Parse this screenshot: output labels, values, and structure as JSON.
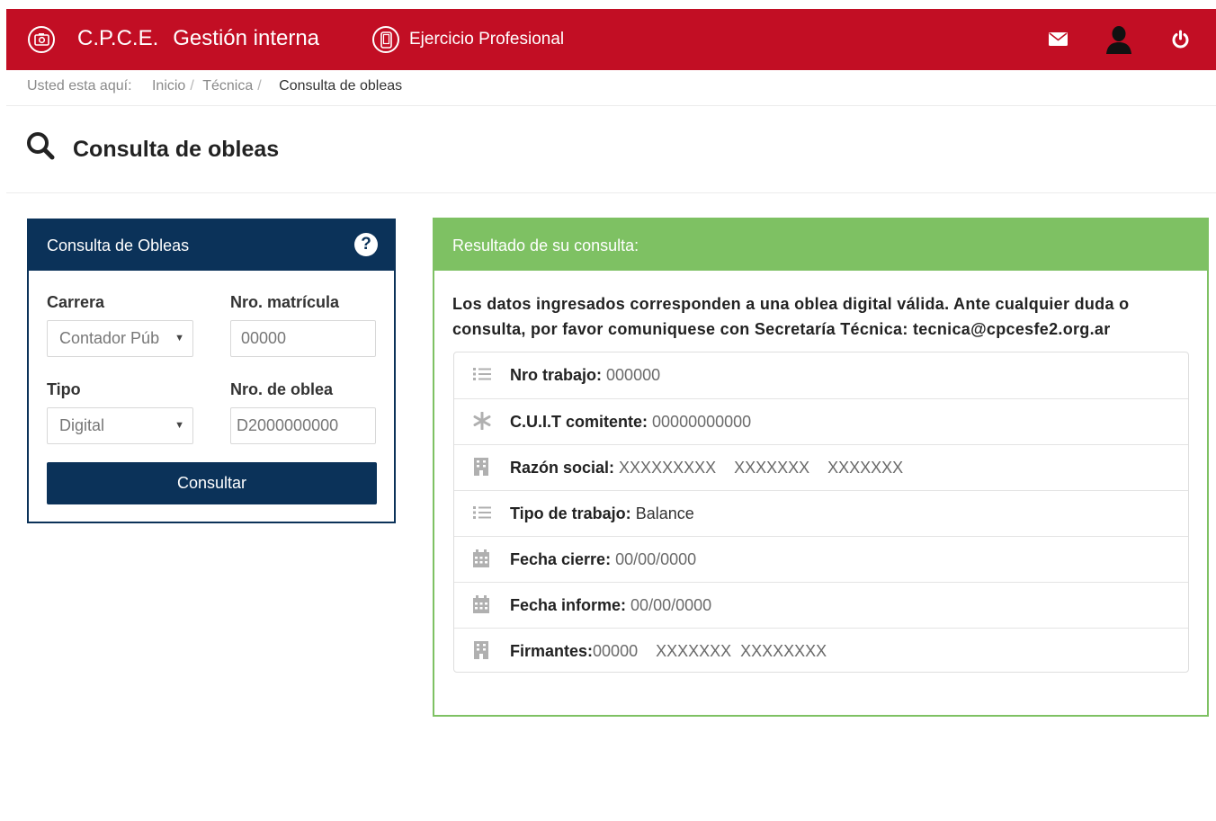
{
  "header": {
    "brand": "C.P.C.E.",
    "app_name": "Gestión interna",
    "section": "Ejercicio Profesional",
    "icons": [
      "camera-icon",
      "phone-icon",
      "mail-icon",
      "user-icon",
      "power-icon"
    ],
    "background_color": "#c20e24"
  },
  "breadcrumb": {
    "prefix": "Usted esta aquí:",
    "items": [
      "Inicio",
      "Técnica"
    ],
    "separator": "/",
    "current": "Consulta de obleas"
  },
  "page": {
    "title": "Consulta de obleas",
    "title_icon": "search-icon"
  },
  "query_panel": {
    "title": "Consulta de Obleas",
    "help_label": "?",
    "header_color": "#0b3259",
    "fields": {
      "carrera_label": "Carrera",
      "carrera_value": "Contador Púb",
      "matricula_label": "Nro. matrícula",
      "matricula_value": "00000",
      "tipo_label": "Tipo",
      "tipo_value": "Digital",
      "oblea_label": "Nro. de oblea",
      "oblea_value": "D2000000000"
    },
    "submit_label": "Consultar"
  },
  "result_panel": {
    "title": "Resultado de su consulta:",
    "header_color": "#7ec163",
    "message": "Los datos ingresados corresponden a una oblea digital válida. Ante cualquier duda o consulta, por favor comuniquese con Secretaría Técnica: tecnica@cpcesfe2.org.ar",
    "rows": [
      {
        "icon": "list-icon",
        "label": "Nro trabajo:",
        "value": "000000"
      },
      {
        "icon": "asterisk-icon",
        "label": "C.U.I.T comitente:",
        "value": "00000000000"
      },
      {
        "icon": "building-icon",
        "label": "Razón social:",
        "value": "XXXXXXXXX    XXXXXXX    XXXXXXX"
      },
      {
        "icon": "list-icon",
        "label": "Tipo de trabajo:",
        "value": "Balance"
      },
      {
        "icon": "calendar-icon",
        "label": "Fecha cierre:",
        "value": "00/00/0000"
      },
      {
        "icon": "calendar-icon",
        "label": "Fecha informe:",
        "value": "00/00/0000"
      },
      {
        "icon": "building-icon",
        "label": "Firmantes:",
        "value": "00000    XXXXXXX  XXXXXXXX"
      }
    ]
  }
}
